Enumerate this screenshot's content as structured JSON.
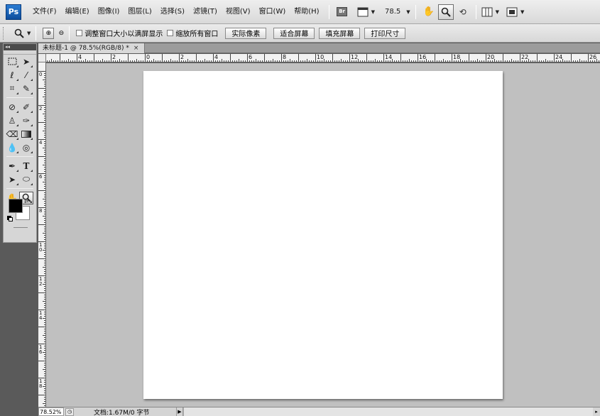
{
  "app": {
    "logo": "Ps"
  },
  "menubar": {
    "items": [
      {
        "label": "文件(F)"
      },
      {
        "label": "编辑(E)"
      },
      {
        "label": "图像(I)"
      },
      {
        "label": "图层(L)"
      },
      {
        "label": "选择(S)"
      },
      {
        "label": "滤镜(T)"
      },
      {
        "label": "视图(V)"
      },
      {
        "label": "窗口(W)"
      },
      {
        "label": "帮助(H)"
      }
    ],
    "bridge_label": "Br",
    "zoom_value": "78.5",
    "icons": [
      "bridge-icon",
      "screen-layout-icon",
      "hand-icon",
      "zoom-icon",
      "rotate-view-icon",
      "arrange-documents-icon",
      "screen-mode-icon"
    ]
  },
  "options": {
    "resize_windows_label": "调整窗口大小以满屏显示",
    "zoom_all_label": "缩放所有窗口",
    "actual_pixels_label": "实际像素",
    "fit_screen_label": "适合屏幕",
    "fill_screen_label": "填充屏幕",
    "print_size_label": "打印尺寸",
    "resize_windows_checked": false,
    "zoom_all_checked": false
  },
  "document": {
    "tab_title": "未标题-1 @ 78.5%(RGB/8) *",
    "close_glyph": "×",
    "background_color": "#ffffff"
  },
  "rulers": {
    "horizontal_labels": [
      "0",
      "2",
      "4",
      "6",
      "8",
      "10",
      "12",
      "14",
      "16",
      "18",
      "20",
      "22",
      "24",
      "26"
    ],
    "vertical_labels": [
      "0",
      "2",
      "4",
      "6",
      "8",
      "10",
      "12",
      "14",
      "16",
      "18"
    ]
  },
  "toolbox": {
    "tools": [
      [
        "marquee-tool-icon",
        "move-tool-icon"
      ],
      [
        "lasso-tool-icon",
        "magic-wand-tool-icon"
      ],
      [
        "crop-tool-icon",
        "eyedropper-tool-icon"
      ],
      [
        "healing-brush-tool-icon",
        "brush-tool-icon"
      ],
      [
        "clone-stamp-tool-icon",
        "history-brush-tool-icon"
      ],
      [
        "eraser-tool-icon",
        "gradient-tool-icon"
      ],
      [
        "blur-tool-icon",
        "dodge-tool-icon"
      ],
      [
        "pen-tool-icon",
        "type-tool-icon"
      ],
      [
        "path-selection-tool-icon",
        "shape-tool-icon"
      ],
      [
        "hand-tool-icon",
        "zoom-tool-icon"
      ]
    ],
    "selected_tool": "zoom-tool-icon",
    "foreground_color": "#000000",
    "background_color": "#ffffff"
  },
  "status": {
    "zoom": "78.52%",
    "doc_info": "文档:1.67M/0 字节"
  }
}
